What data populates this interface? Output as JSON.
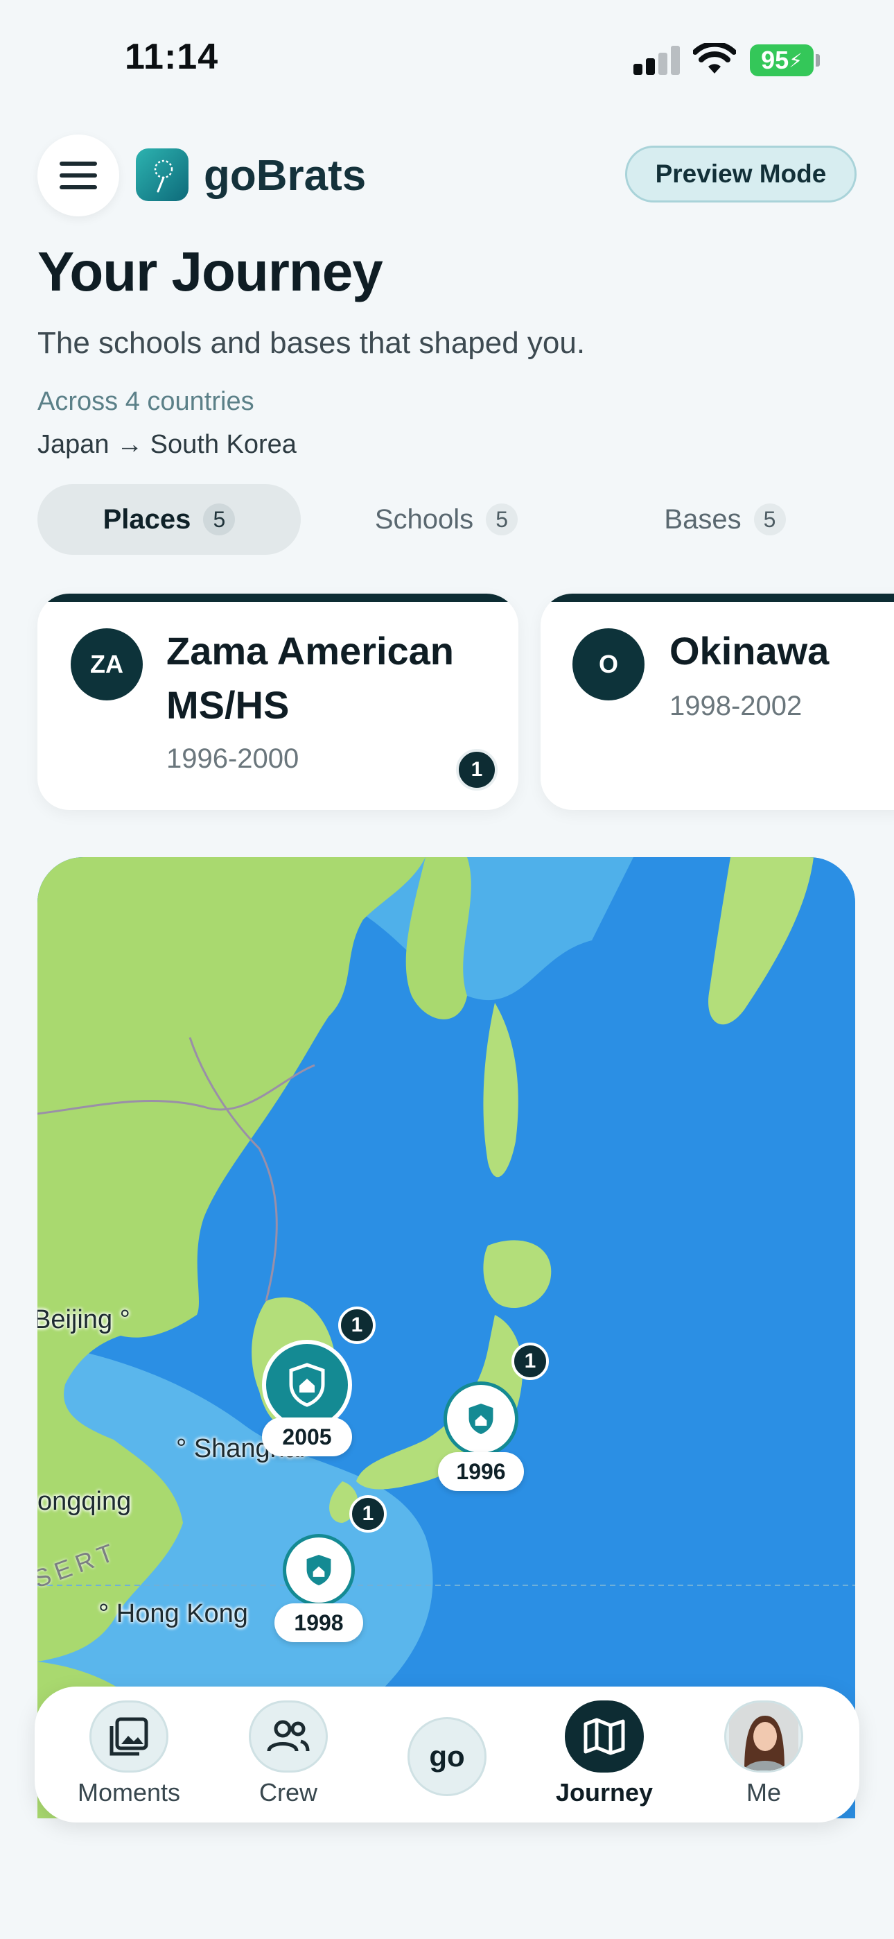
{
  "status_bar": {
    "time": "11:14",
    "battery": "95"
  },
  "header": {
    "brand": "goBrats",
    "preview_label": "Preview Mode"
  },
  "page": {
    "title": "Your Journey",
    "subtitle": "The schools and bases that shaped you.",
    "countries": "Across 4 countries",
    "route": "Japan → South Korea"
  },
  "tabs": [
    {
      "label": "Places",
      "count": "5",
      "active": true
    },
    {
      "label": "Schools",
      "count": "5",
      "active": false
    },
    {
      "label": "Bases",
      "count": "5",
      "active": false
    }
  ],
  "cards": [
    {
      "initials": "ZA",
      "title": "Zama American MS/HS",
      "years": "1996-2000",
      "badge": "1"
    },
    {
      "initials": "O",
      "title": "Okinawa",
      "years": "1998-2002"
    }
  ],
  "map": {
    "labels": {
      "beijing": "Beijing",
      "shanghai": "Shanghai",
      "chongqing": "ongqing",
      "hong_kong": "Hong Kong",
      "desert": "SERT"
    },
    "pins": [
      {
        "year": "2005",
        "count": "1"
      },
      {
        "year": "1996",
        "count": "1"
      },
      {
        "year": "1998",
        "count": "1"
      }
    ],
    "colors": {
      "ocean": "#2b8fe4",
      "land": "#a9d96f",
      "pin": "#148a93"
    }
  },
  "nav": {
    "moments": "Moments",
    "crew": "Crew",
    "go": "go",
    "journey": "Journey",
    "me": "Me"
  }
}
